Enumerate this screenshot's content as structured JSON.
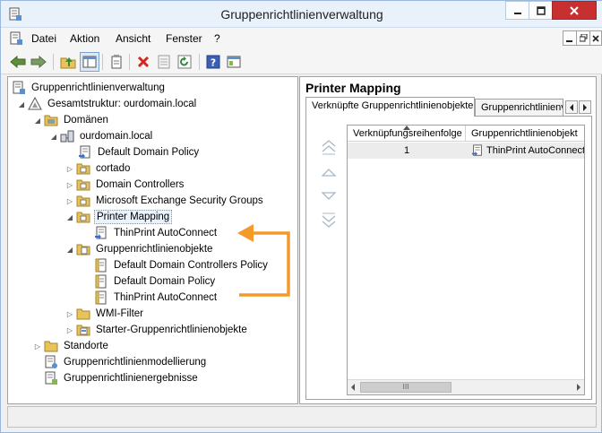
{
  "window": {
    "title": "Gruppenrichtlinienverwaltung",
    "minimize_icon": "minimize-icon",
    "restore_icon": "restore-icon",
    "close_icon": "close-icon"
  },
  "menu": {
    "items": [
      "Datei",
      "Aktion",
      "Ansicht",
      "Fenster",
      "?"
    ]
  },
  "toolbar": {
    "buttons": [
      "back-arrow-icon",
      "forward-arrow-icon",
      "up-folder-icon",
      "show-hide-tree-icon",
      "properties-icon",
      "delete-icon",
      "export-list-icon",
      "refresh-icon",
      "help-icon",
      "console-icon"
    ]
  },
  "tree": {
    "root": "Gruppenrichtlinienverwaltung",
    "forest": "Gesamtstruktur: ourdomain.local",
    "domains": "Domänen",
    "domain": "ourdomain.local",
    "default_domain_policy": "Default Domain Policy",
    "cortado": "cortado",
    "domain_controllers": "Domain Controllers",
    "exchange_groups": "Microsoft Exchange Security Groups",
    "printer_mapping": "Printer Mapping",
    "thinprint_link": "ThinPrint AutoConnect",
    "gpo_container": "Gruppenrichtlinienobjekte",
    "gpo_dc_policy": "Default Domain Controllers Policy",
    "gpo_domain_policy": "Default Domain Policy",
    "gpo_thinprint": "ThinPrint AutoConnect",
    "wmi_filter": "WMI-Filter",
    "starter_gpos": "Starter-Gruppenrichtlinienobjekte",
    "sites": "Standorte",
    "modeling": "Gruppenrichtlinienmodellierung",
    "results": "Gruppenrichtlinienergebnisse"
  },
  "right": {
    "title": "Printer Mapping",
    "tabs": [
      "Verknüpfte Gruppenrichtlinienobjekte",
      "Gruppenrichtlinienv"
    ],
    "columns": [
      "Verknüpfungsreihenfolge",
      "Gruppenrichtlinienobjekt"
    ],
    "rows": [
      {
        "order": "1",
        "gpo": "ThinPrint AutoConnect"
      }
    ],
    "scroll_thumb": "III"
  },
  "colors": {
    "accent_arrow": "#f39a2b",
    "close_button": "#c7302e",
    "folder": "#e8c25a"
  }
}
